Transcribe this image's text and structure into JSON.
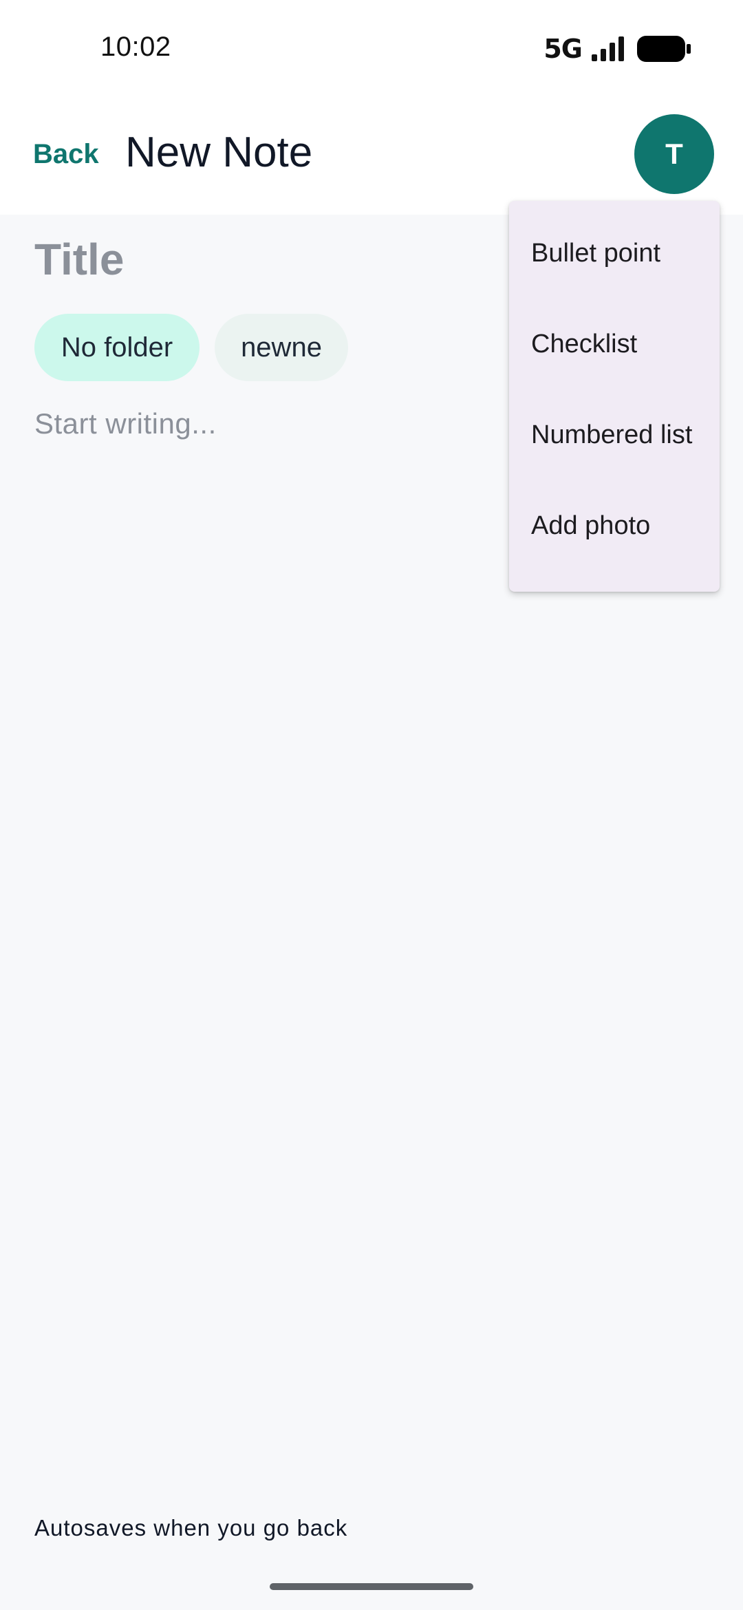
{
  "status_bar": {
    "time": "10:02",
    "network_label": "5G",
    "signal_icon": "signal-bars-icon",
    "battery_icon": "battery-full-icon"
  },
  "header": {
    "back_label": "Back",
    "title": "New Note",
    "avatar_initial": "T"
  },
  "editor": {
    "title_placeholder": "Title",
    "folder_chip": "No folder",
    "tag_chip": "newne",
    "body_placeholder": "Start writing..."
  },
  "menu": {
    "items": [
      {
        "label": "Bullet point"
      },
      {
        "label": "Checklist"
      },
      {
        "label": "Numbered list"
      },
      {
        "label": "Add photo"
      }
    ]
  },
  "footer": {
    "autosave_note": "Autosaves when you go back"
  },
  "colors": {
    "accent": "#0f766e",
    "background": "#f7f8fa",
    "chip_folder_bg": "#ccf8ec",
    "chip_tag_bg": "#ebf3f1",
    "menu_bg": "#f1ebf5",
    "placeholder_text": "#8b9099"
  }
}
